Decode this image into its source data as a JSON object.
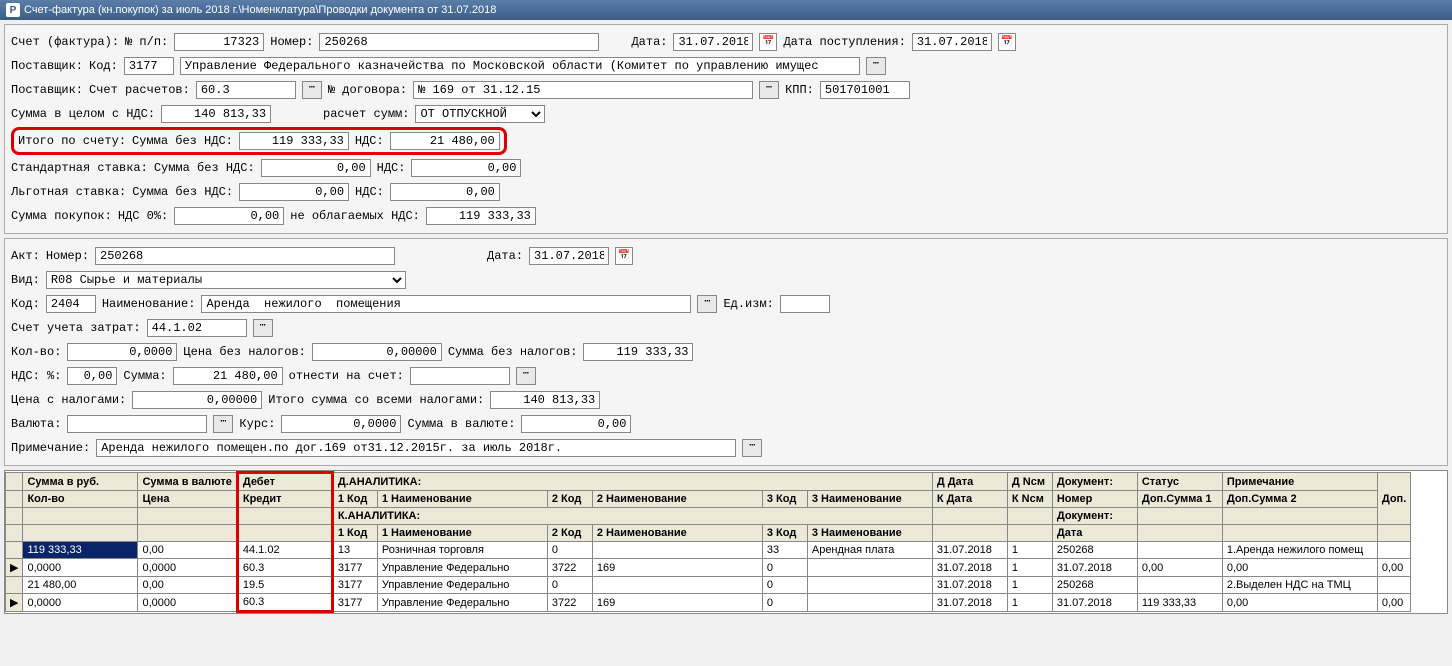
{
  "title": "Счет-фактура (кн.покупок) за июль 2018 г.\\Номенклатура\\Проводки документа  от 31.07.2018",
  "header": {
    "invoice_label": "Счет (фактура):",
    "np_label": "№ п/п:",
    "np_value": "17323",
    "number_label": "Номер:",
    "number_value": "250268",
    "date_label": "Дата:",
    "date_value": "31.07.2018",
    "receipt_date_label": "Дата поступления:",
    "receipt_date_value": "31.07.2018",
    "supplier_label": "Поставщик:",
    "code_label": "Код:",
    "supplier_code": "3177",
    "supplier_name": "Управление Федерального казначейства по Московской области (Комитет по управлению имущес",
    "account_label": "Счет расчетов:",
    "account_value": "60.3",
    "contract_label": "№ договора:",
    "contract_value": "№ 169 от 31.12.15",
    "kpp_label": "КПП:",
    "kpp_value": "501701001",
    "sum_vat_label": "Сумма в целом с НДС:",
    "sum_vat_value": "140 813,33",
    "calc_label": "расчет сумм:",
    "calc_value": "ОТ ОТПУСКНОЙ",
    "total_label": "Итого   по   счету:",
    "sum_novat_label": "Сумма без НДС:",
    "sum_novat_value": "119 333,33",
    "vat_label": "НДС:",
    "vat_value": "21 480,00",
    "std_rate_label": "Стандартная ставка:",
    "std_novat": "0,00",
    "std_vat": "0,00",
    "pref_rate_label": "Льготная    ставка:",
    "pref_novat": "0,00",
    "pref_vat": "0,00",
    "sum_purchases_label": "Сумма покупок:",
    "vat0_label": "НДС 0%:",
    "vat0_value": "0,00",
    "notaxed_label": "не облагаемых НДС:",
    "notaxed_value": "119 333,33"
  },
  "detail": {
    "act_label": "Акт:",
    "number_label": "Номер:",
    "act_number": "250268",
    "date_label": "Дата:",
    "act_date": "31.07.2018",
    "kind_label": "Вид:",
    "kind_value": "R08 Сырье и материалы",
    "code_label": "Код:",
    "nom_code": "2404",
    "name_label": "Наименование:",
    "nom_name": "Аренда  нежилого  помещения",
    "unit_label": "Ед.изм:",
    "unit_value": "",
    "cost_account_label": "Счет учета затрат:",
    "cost_account": "44.1.02",
    "qty_label": "Кол-во:",
    "qty_value": "0,0000",
    "price_notax_label": "Цена без налогов:",
    "price_notax": "0,00000",
    "sum_notax_label": "Сумма без налогов:",
    "sum_notax": "119 333,33",
    "vat_pct_label": "НДС:  %:",
    "vat_pct": "0,00",
    "sum_label": "Сумма:",
    "vat_sum": "21 480,00",
    "assign_label": "отнести на счет:",
    "assign_value": "",
    "price_tax_label": "Цена с налогами:",
    "price_tax": "0,00000",
    "total_tax_label": "Итого сумма со всеми налогами:",
    "total_tax": "140 813,33",
    "currency_label": "Валюта:",
    "currency": "",
    "rate_label": "Курс:",
    "rate": "0,0000",
    "sum_cur_label": "Сумма в валюте:",
    "sum_cur": "0,00",
    "note_label": "Примечание:",
    "note_value": "Аренда нежилого помещен.по дог.169 от31.12.2015г. за июль 2018г."
  },
  "grid": {
    "hdr": {
      "sum_rub": "Сумма в руб.",
      "sum_cur": "Сумма в валюте",
      "debit": "Дебет",
      "d_analytics": "Д.АНАЛИТИКА:",
      "d_date": "Д Дата",
      "d_ncm": "Д Ncм",
      "document": "Документ:",
      "status": "Статус",
      "note": "Примечание",
      "qty": "Кол-во",
      "price": "Цена",
      "credit": "Кредит",
      "code1": "1 Код",
      "name1": "1 Наименование",
      "code2": "2 Код",
      "name2": "2 Наименование",
      "code3": "3 Код",
      "name3": "3 Наименование",
      "k_date": "К Дата",
      "k_ncm": "К Ncм",
      "number": "Номер",
      "dopsum1": "Доп.Сумма 1",
      "dopsum2": "Доп.Сумма 2",
      "k_analytics": "К.АНАЛИТИКА:",
      "date": "Дата",
      "dop": "Доп."
    },
    "rows": [
      {
        "r0": "119 333,33",
        "r1": "0,00",
        "r2": "44.1.02",
        "r3": "13",
        "r4": "Розничная торговля",
        "r5": "0",
        "r6": "",
        "r7": "33",
        "r8": "Арендная плата",
        "r9": "31.07.2018",
        "r10": "1",
        "r11": "250268",
        "r12": "",
        "r13": "1.Аренда нежилого помещ",
        "sel": true
      },
      {
        "r0": "0,0000",
        "r1": "0,0000",
        "r2": "60.3",
        "r3": "3177",
        "r4": "Управление Федерально",
        "r5": "3722",
        "r6": "169",
        "r7": "0",
        "r8": "",
        "r9": "31.07.2018",
        "r10": "1",
        "r11": "31.07.2018",
        "r12": "0,00",
        "r13": "0,00",
        "r14": "0,00",
        "mark": true
      },
      {
        "r0": "21 480,00",
        "r1": "0,00",
        "r2": "19.5",
        "r3": "3177",
        "r4": "Управление Федерально",
        "r5": "0",
        "r6": "",
        "r7": "0",
        "r8": "",
        "r9": "31.07.2018",
        "r10": "1",
        "r11": "250268",
        "r12": "",
        "r13": "2.Выделен НДС на ТМЦ"
      },
      {
        "r0": "0,0000",
        "r1": "0,0000",
        "r2": "60.3",
        "r3": "3177",
        "r4": "Управление Федерально",
        "r5": "3722",
        "r6": "169",
        "r7": "0",
        "r8": "",
        "r9": "31.07.2018",
        "r10": "1",
        "r11": "31.07.2018",
        "r12": "119 333,33",
        "r13": "0,00",
        "r14": "0,00",
        "mark": true
      }
    ]
  }
}
